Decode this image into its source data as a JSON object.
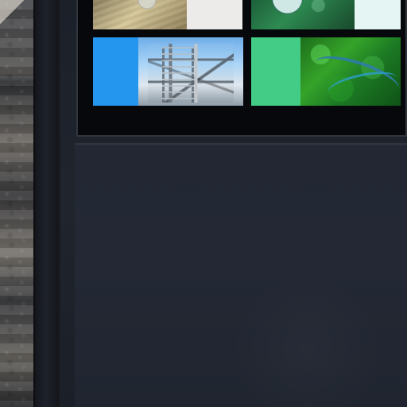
{
  "scene": {
    "left_panel": {
      "pattern": "decorative-carpet",
      "icons": [
        "wall-pattern-icon"
      ]
    },
    "gallery": {
      "tiles": [
        {
          "name": "tile-top-left",
          "media_icon": "landscape-photo-icon",
          "accent": "#ecebea"
        },
        {
          "name": "tile-top-right",
          "media_icon": "aerial-photo-icon",
          "accent": "#e5f5f3"
        },
        {
          "name": "tile-industrial",
          "media_icon": "industrial-photo-icon",
          "accent": "#2496ee"
        },
        {
          "name": "tile-forest",
          "media_icon": "forest-river-photo-icon",
          "accent": "#43cc86"
        }
      ]
    },
    "colors": {
      "frame": "#07080b",
      "panel": "#222733",
      "beam": "#1e222a"
    }
  }
}
